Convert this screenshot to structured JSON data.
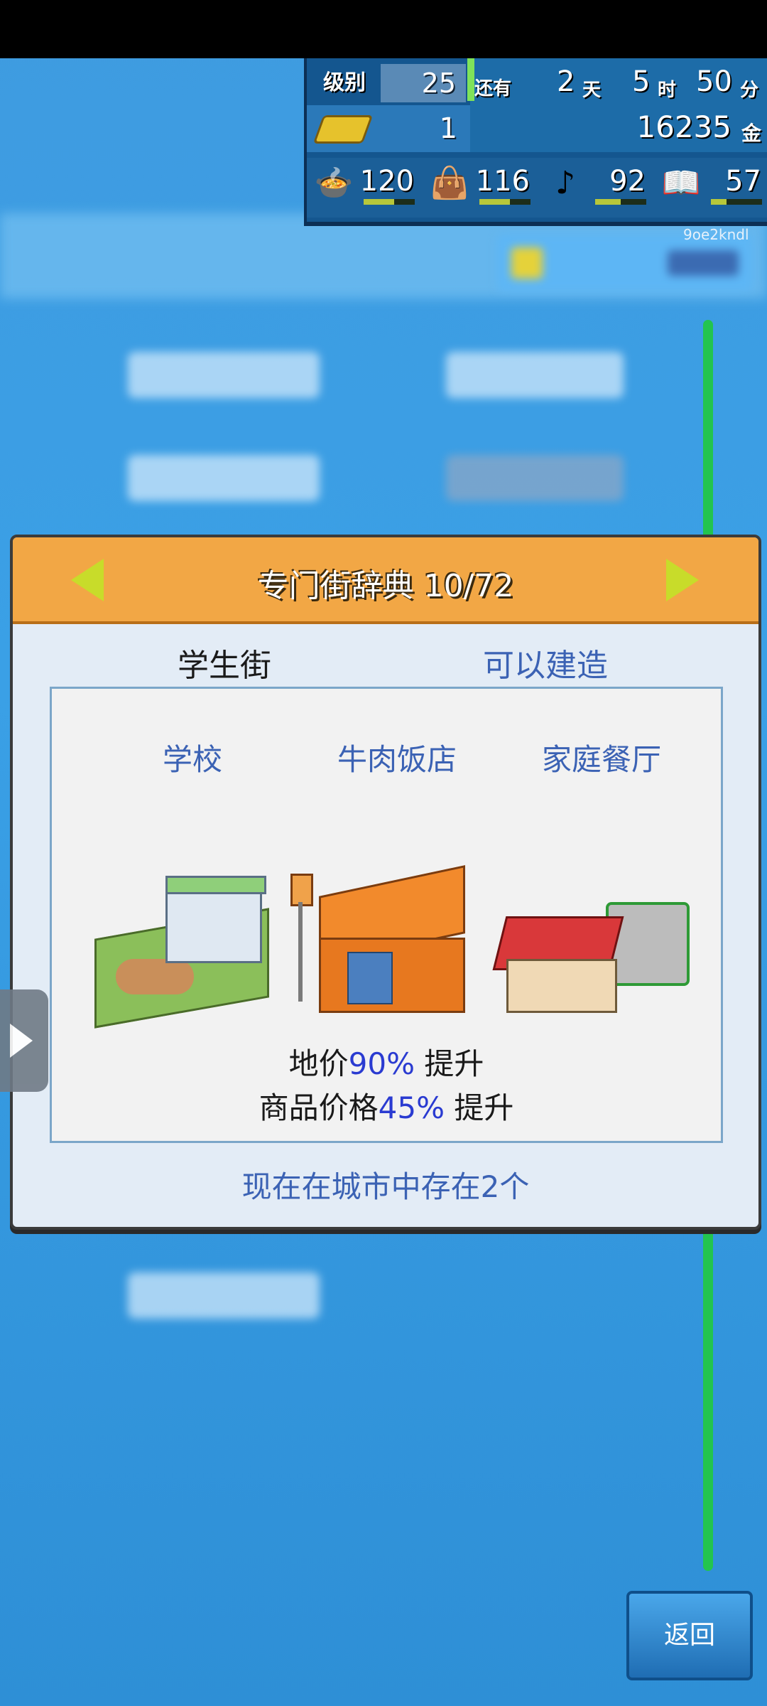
{
  "hud": {
    "level_label": "级别",
    "level_value": "25",
    "remaining_label": "还有",
    "days_value": "2",
    "days_unit": "天",
    "hours_value": "5",
    "hours_unit": "时",
    "minutes_value": "50",
    "minutes_unit": "分",
    "gold_bars": "1",
    "money": "16235",
    "money_unit": "金",
    "stats": [
      {
        "icon": "food-icon",
        "value": "120",
        "level": 0.6
      },
      {
        "icon": "goods-icon",
        "value": "116",
        "level": 0.6
      },
      {
        "icon": "music-icon",
        "value": "92",
        "level": 0.5
      },
      {
        "icon": "book-icon",
        "value": "57",
        "level": 0.3
      }
    ]
  },
  "watermark": "9oe2kndl",
  "dialog": {
    "title": "专门街辞典 10/72",
    "street_name": "学生街",
    "status": "可以建造",
    "buildings": [
      "学校",
      "牛肉饭店",
      "家庭餐厅"
    ],
    "effect_land_prefix": "地价",
    "effect_land_pct": "90%",
    "effect_land_suffix": " 提升",
    "effect_goods_prefix": "商品价格",
    "effect_goods_pct": "45%",
    "effect_goods_suffix": " 提升",
    "existing_count_text": "现在在城市中存在2个"
  },
  "buttons": {
    "back": "返回"
  },
  "colors": {
    "accent_blue": "#3b62b4",
    "highlight": "#2a3bd1",
    "header_orange": "#f2a745"
  }
}
